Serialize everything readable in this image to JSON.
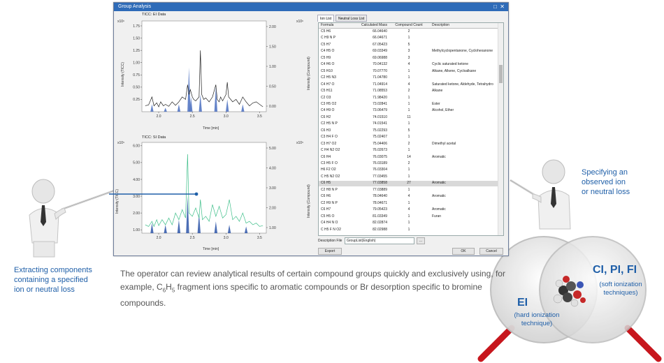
{
  "window": {
    "title": "Group Analysis",
    "max_icon": "□",
    "close_icon": "✕"
  },
  "ei_chart": {
    "title": "TICC: EI Data",
    "left_multiplier": "x10⁶",
    "right_multiplier": "x10⁶",
    "ylabel_left": "Intensity (TICC)",
    "ylabel_right": "Intensity (Compound)",
    "xlabel": "Time [min]",
    "left_ticks": [
      "1.75",
      "1.50",
      "1.25",
      "1.00",
      "0.75",
      "0.50",
      "0.25"
    ],
    "right_ticks": [
      "2.00",
      "1.50",
      "1.00",
      "0.50",
      "0.00"
    ],
    "x_ticks": [
      "2.0",
      "2.5",
      "3.0",
      "3.5"
    ]
  },
  "si_chart": {
    "title": "TICC: SI Data",
    "left_multiplier": "x10⁵",
    "right_multiplier": "x10⁵",
    "ylabel_left": "Intensity (TICC)",
    "ylabel_right": "Intensity (Compound)",
    "xlabel": "Time [min]",
    "left_ticks": [
      "6.00",
      "5.00",
      "4.00",
      "3.00",
      "2.00",
      "1.00"
    ],
    "right_ticks": [
      "5.00",
      "4.00",
      "3.00",
      "2.00",
      "1.00"
    ],
    "x_ticks": [
      "2.0",
      "2.5",
      "3.0",
      "3.5"
    ]
  },
  "chart_data": [
    {
      "type": "line",
      "title": "TICC: EI Data",
      "xlabel": "Time [min]",
      "ylabel": "Intensity (TICC)",
      "xlim": [
        1.75,
        3.6
      ],
      "ylim": [
        0,
        1.85
      ],
      "series_ticc": [
        [
          1.8,
          0.12
        ],
        [
          1.85,
          0.14
        ],
        [
          1.9,
          0.3
        ],
        [
          1.93,
          0.12
        ],
        [
          1.97,
          0.18
        ],
        [
          2.0,
          0.1
        ],
        [
          2.03,
          0.2
        ],
        [
          2.07,
          0.12
        ],
        [
          2.1,
          0.15
        ],
        [
          2.15,
          0.11
        ],
        [
          2.2,
          0.2
        ],
        [
          2.25,
          0.13
        ],
        [
          2.3,
          0.2
        ],
        [
          2.35,
          0.3
        ],
        [
          2.4,
          0.25
        ],
        [
          2.43,
          0.55
        ],
        [
          2.45,
          0.35
        ],
        [
          2.47,
          0.45
        ],
        [
          2.5,
          0.3
        ],
        [
          2.52,
          0.25
        ],
        [
          2.55,
          0.22
        ],
        [
          2.6,
          0.3
        ],
        [
          2.62,
          1.25
        ],
        [
          2.64,
          0.35
        ],
        [
          2.67,
          0.25
        ],
        [
          2.7,
          0.28
        ],
        [
          2.75,
          0.2
        ],
        [
          2.8,
          0.3
        ],
        [
          2.85,
          0.55
        ],
        [
          2.87,
          0.25
        ],
        [
          2.9,
          0.2
        ],
        [
          2.92,
          0.3
        ],
        [
          2.95,
          0.22
        ],
        [
          3.0,
          0.35
        ],
        [
          3.02,
          0.6
        ],
        [
          3.04,
          0.3
        ],
        [
          3.07,
          0.25
        ],
        [
          3.1,
          0.2
        ],
        [
          3.15,
          0.25
        ],
        [
          3.2,
          0.15
        ],
        [
          3.25,
          0.3
        ],
        [
          3.3,
          0.2
        ],
        [
          3.35,
          0.12
        ],
        [
          3.4,
          0.18
        ],
        [
          3.45,
          0.2
        ],
        [
          3.5,
          0.15
        ],
        [
          3.55,
          0.1
        ]
      ],
      "series_compound": [
        [
          1.9,
          0.15
        ],
        [
          2.1,
          0.08
        ],
        [
          2.3,
          0.15
        ],
        [
          2.45,
          0.9
        ],
        [
          2.48,
          0.3
        ],
        [
          2.62,
          0.35
        ],
        [
          2.85,
          0.5
        ],
        [
          3.02,
          0.25
        ],
        [
          3.25,
          0.15
        ]
      ]
    },
    {
      "type": "line",
      "title": "TICC: SI Data",
      "xlabel": "Time [min]",
      "ylabel": "Intensity (TICC)",
      "xlim": [
        1.75,
        3.6
      ],
      "ylim": [
        0.8,
        6.2
      ],
      "series_ticc": [
        [
          1.8,
          1.3
        ],
        [
          1.85,
          1.2
        ],
        [
          1.9,
          1.5
        ],
        [
          1.93,
          1.2
        ],
        [
          1.97,
          1.6
        ],
        [
          2.0,
          1.25
        ],
        [
          2.05,
          1.6
        ],
        [
          2.1,
          1.3
        ],
        [
          2.15,
          1.7
        ],
        [
          2.2,
          1.3
        ],
        [
          2.25,
          2.0
        ],
        [
          2.3,
          1.6
        ],
        [
          2.35,
          2.2
        ],
        [
          2.4,
          1.7
        ],
        [
          2.43,
          5.5
        ],
        [
          2.45,
          2.0
        ],
        [
          2.5,
          1.8
        ],
        [
          2.55,
          2.3
        ],
        [
          2.6,
          1.7
        ],
        [
          2.62,
          2.8
        ],
        [
          2.65,
          1.6
        ],
        [
          2.7,
          1.8
        ],
        [
          2.75,
          1.5
        ],
        [
          2.8,
          2.5
        ],
        [
          2.85,
          1.8
        ],
        [
          2.9,
          2.4
        ],
        [
          2.95,
          1.7
        ],
        [
          3.0,
          1.9
        ],
        [
          3.05,
          2.8
        ],
        [
          3.1,
          1.6
        ],
        [
          3.15,
          1.8
        ],
        [
          3.2,
          1.5
        ],
        [
          3.25,
          2.0
        ],
        [
          3.3,
          1.4
        ],
        [
          3.35,
          1.5
        ],
        [
          3.4,
          1.3
        ],
        [
          3.45,
          1.4
        ],
        [
          3.5,
          1.2
        ],
        [
          3.55,
          1.25
        ]
      ],
      "series_compound": [
        [
          1.9,
          1.4
        ],
        [
          2.1,
          1.3
        ],
        [
          2.3,
          1.6
        ],
        [
          2.43,
          3.0
        ],
        [
          2.6,
          2.0
        ],
        [
          2.85,
          1.5
        ],
        [
          3.05,
          1.3
        ],
        [
          3.3,
          1.2
        ]
      ]
    }
  ],
  "tabs": [
    "Ion List",
    "Neutral Loss List"
  ],
  "table": {
    "headers": [
      "Formula",
      "Calculated Mass",
      "Compound Count",
      "Description"
    ],
    "rows": [
      [
        "C5 H6",
        "66.04640",
        "2",
        ""
      ],
      [
        "C H9 N P",
        "66.04671",
        "1",
        ""
      ],
      [
        "C5 H7",
        "67.05423",
        "5",
        ""
      ],
      [
        "C4 H5 O",
        "69.03349",
        "3",
        "Methylcyclopentanone, Cyclohexanone"
      ],
      [
        "C5 H9",
        "69.06988",
        "3",
        ""
      ],
      [
        "C4 H6 O",
        "70.04132",
        "4",
        "Cyclic saturated ketone"
      ],
      [
        "C5 H10",
        "70.07770",
        "1",
        "Alkane, Alkene, Cycloalkane"
      ],
      [
        "C2 H5 N3",
        "71.04780",
        "1",
        ""
      ],
      [
        "C4 H7 O",
        "71.04914",
        "4",
        "Saturated ketone, Aldehyde, Tetrahydro"
      ],
      [
        "C5 H11",
        "71.08553",
        "2",
        "Alkane"
      ],
      [
        "C2 O3",
        "71.98420",
        "1",
        ""
      ],
      [
        "C3 H5 O2",
        "73.02841",
        "1",
        "Ester"
      ],
      [
        "C4 H9 O",
        "73.06479",
        "1",
        "Alcohol, Ether"
      ],
      [
        "C6 H2",
        "74.01510",
        "11",
        ""
      ],
      [
        "C2 H5 N P",
        "74.01541",
        "1",
        ""
      ],
      [
        "C6 H3",
        "75.02293",
        "5",
        ""
      ],
      [
        "C3 H4 F O",
        "75.02407",
        "1",
        ""
      ],
      [
        "C3 H7 O2",
        "75.04406",
        "2",
        "Dimethyl acetal"
      ],
      [
        "C H4 N2 O2",
        "76.02673",
        "1",
        ""
      ],
      [
        "C6 H4",
        "76.03075",
        "14",
        "Aromatic"
      ],
      [
        "C3 H5 F O",
        "76.03189",
        "2",
        ""
      ],
      [
        "H6 F2 O2",
        "76.03304",
        "1",
        ""
      ],
      [
        "C H5 N2 O2",
        "77.03455",
        "1",
        ""
      ],
      [
        "C6 H5",
        "77.03858",
        "27",
        "Aromatic"
      ],
      [
        "C2 H8 N P",
        "77.03889",
        "1",
        ""
      ],
      [
        "C6 H6",
        "78.04640",
        "4",
        "Aromatic"
      ],
      [
        "C2 H9 N P",
        "78.04671",
        "1",
        ""
      ],
      [
        "C6 H7",
        "79.05423",
        "4",
        "Aromatic"
      ],
      [
        "C5 H5 O",
        "81.03349",
        "1",
        "Furan"
      ],
      [
        "C4 H4 N O",
        "82.02874",
        "1",
        ""
      ],
      [
        "C H5 F N O2",
        "82.02988",
        "1",
        ""
      ]
    ],
    "selected_row": 23
  },
  "description_file_label": "Description File",
  "description_file_value": "GroupList(English)",
  "browse_label": "...",
  "export_label": "Export",
  "ok_label": "OK",
  "cancel_label": "Cancel",
  "annotations": {
    "left": [
      "Extracting components",
      "containing a specified",
      "ion or neutral loss"
    ],
    "right": [
      "Specifying an",
      "observed ion",
      "or neutral loss"
    ],
    "ei_label": "EI",
    "hard_label": [
      "(hard ionization",
      "technique)"
    ],
    "ci_label": "CI, PI, FI",
    "soft_label": [
      "(soft ionization",
      "techniques)"
    ]
  },
  "description": {
    "part1": "The operator can review analytical results of certain compound groups quickly and exclusively using, for example, C",
    "sub1": "6",
    "part2": "H",
    "sub2": "5",
    "part3": " fragment ions specific to aromatic compounds or Br desorption specific to bromine compounds."
  },
  "colors": {
    "accent": "#1f5fa8",
    "ei_compound": "#4a6fc0",
    "si_ticc": "#3fbf8a",
    "si_compound": "#2d55a8",
    "ticc_line": "#222222",
    "magnifier_handle": "#c7161d"
  }
}
